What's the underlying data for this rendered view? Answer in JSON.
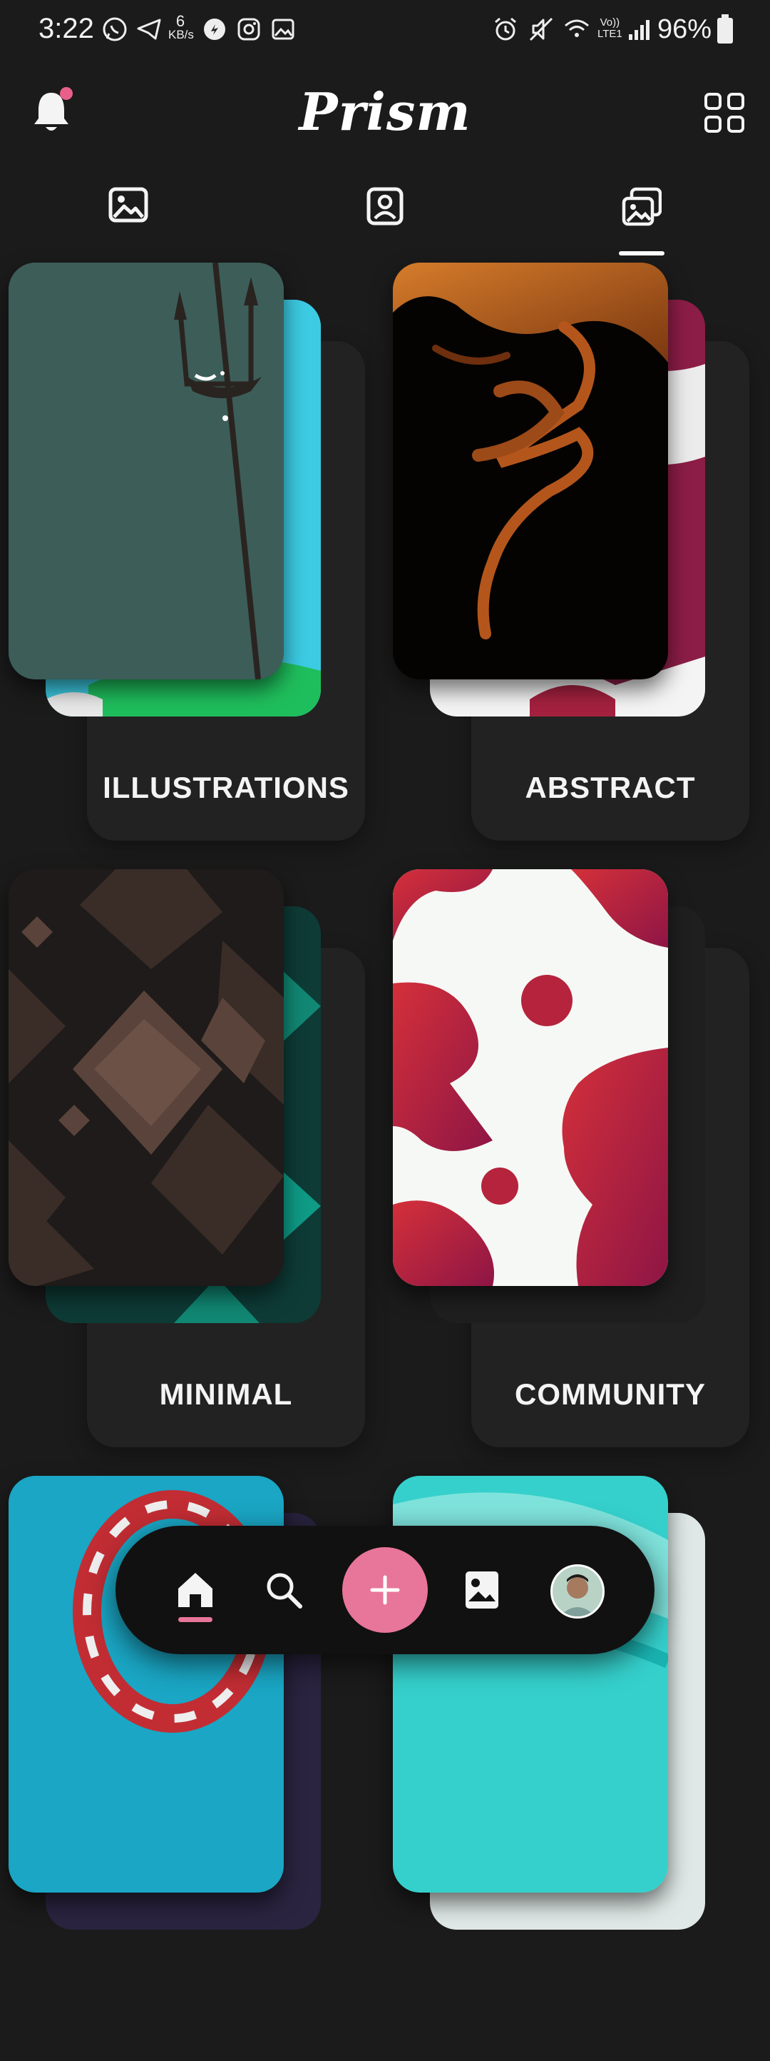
{
  "status": {
    "time": "3:22",
    "speed_value": "6",
    "speed_unit": "KB/s",
    "volte_top": "Vo))",
    "volte_bottom": "LTE1",
    "battery": "96%"
  },
  "header": {
    "title": "Prism",
    "icons": [
      "notification-bell-icon",
      "grid-icon"
    ]
  },
  "tabs": [
    {
      "icon": "wallpapers-icon",
      "selected": false
    },
    {
      "icon": "profile-icon",
      "selected": false
    },
    {
      "icon": "collections-icon",
      "selected": true
    }
  ],
  "categories": [
    {
      "label": "ILLUSTRATIONS"
    },
    {
      "label": "ABSTRACT"
    },
    {
      "label": "MINIMAL"
    },
    {
      "label": "COMMUNITY"
    }
  ],
  "bottom_nav": {
    "items": [
      "home-icon",
      "search-icon",
      "add-icon",
      "gallery-icon",
      "avatar"
    ],
    "accent": "#e8759a"
  }
}
